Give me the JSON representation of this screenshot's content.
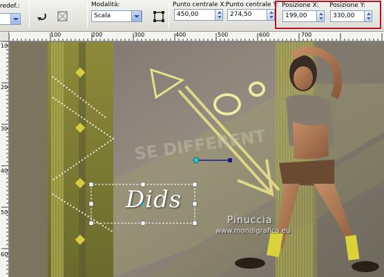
{
  "toolbar": {
    "preset_label": "redef.:",
    "mode_label": "Modalità:",
    "mode_value": "Scala",
    "center_x_label": "Punto centrale X:",
    "center_x_value": "450,00",
    "center_y_label": "Punto centrale Y:",
    "center_y_value": "274,50",
    "pos_x_label": "Posizione X:",
    "pos_x_value": "199,00",
    "pos_y_label": "Posizione Y:",
    "pos_y_value": "330,00",
    "highlight_color": "#b8121f"
  },
  "ruler": {
    "h_labels": [
      "100",
      "200",
      "300",
      "400",
      "500",
      "600",
      "700"
    ],
    "v_labels": [
      "100",
      "200",
      "300",
      "400",
      "500",
      "600"
    ]
  },
  "canvas": {
    "title_text": "Dids",
    "background_text": "SE DIFFERENT",
    "watermark_name": "Pinuccia",
    "watermark_site": "www.mondigrafica.eu",
    "colors": {
      "background": "#8c8378",
      "accent_olive": "#a7a347",
      "gold_arrow": "#e8e08a",
      "selection": "#ffffff"
    }
  }
}
